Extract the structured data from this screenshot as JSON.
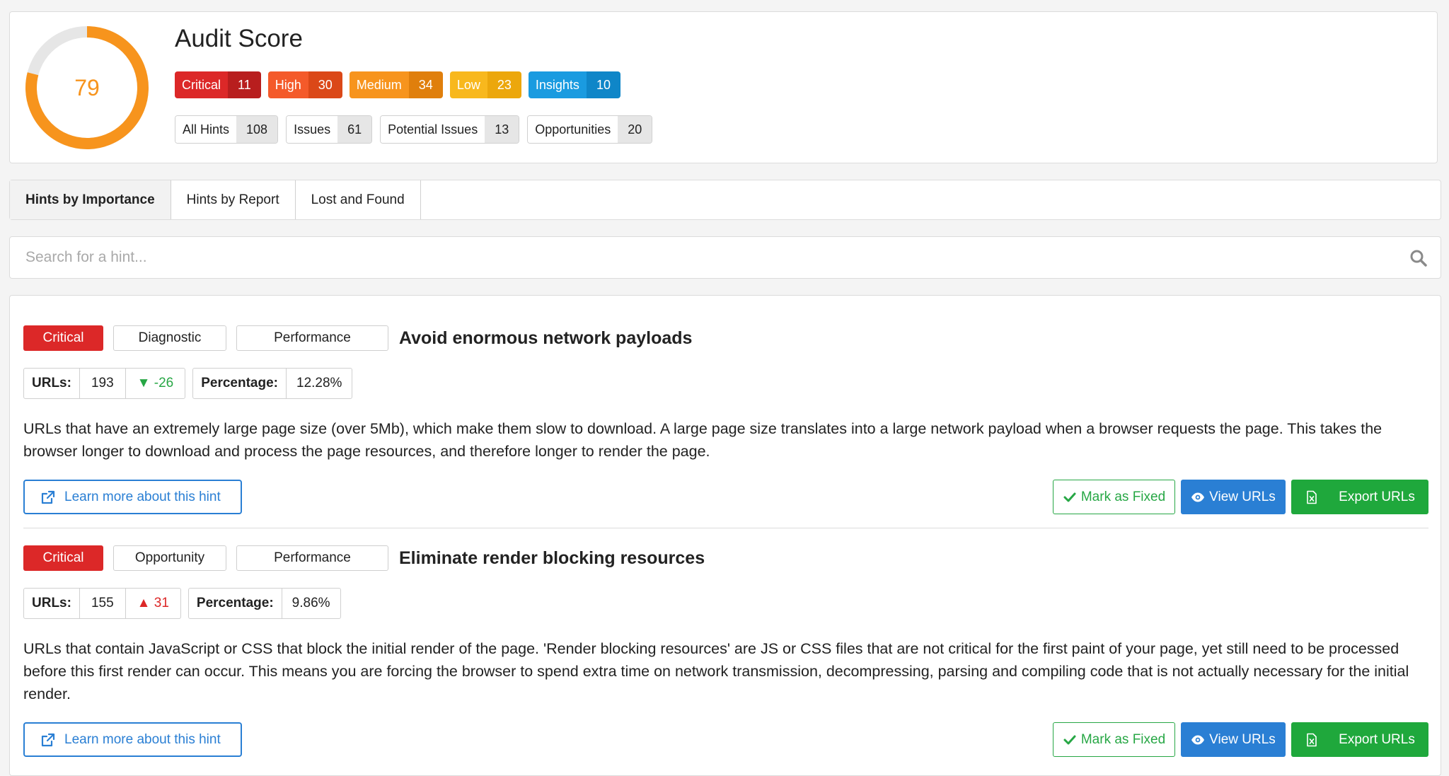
{
  "score": {
    "value": "79",
    "fraction": 0.79,
    "color": "#f7941d",
    "title": "Audit Score"
  },
  "severities": [
    {
      "label": "Critical",
      "count": "11",
      "color": "#dc2828",
      "dark": "#b81e1e"
    },
    {
      "label": "High",
      "count": "30",
      "color": "#f45a2a",
      "dark": "#db4818"
    },
    {
      "label": "Medium",
      "count": "34",
      "color": "#f7941d",
      "dark": "#e07f0c"
    },
    {
      "label": "Low",
      "count": "23",
      "color": "#f8b81d",
      "dark": "#eca70c"
    },
    {
      "label": "Insights",
      "count": "10",
      "color": "#1a9be0",
      "dark": "#0f86c8"
    }
  ],
  "counts": [
    {
      "label": "All Hints",
      "count": "108"
    },
    {
      "label": "Issues",
      "count": "61"
    },
    {
      "label": "Potential Issues",
      "count": "13"
    },
    {
      "label": "Opportunities",
      "count": "20"
    }
  ],
  "tabs": [
    {
      "label": "Hints by Importance",
      "active": true
    },
    {
      "label": "Hints by Report",
      "active": false
    },
    {
      "label": "Lost and Found",
      "active": false
    }
  ],
  "search": {
    "placeholder": "Search for a hint..."
  },
  "hints": [
    {
      "severity": "Critical",
      "type": "Diagnostic",
      "category": "Performance",
      "title": "Avoid enormous network payloads",
      "urls_label": "URLs:",
      "urls": "193",
      "delta": "-26",
      "delta_dir": "down",
      "pct_label": "Percentage:",
      "pct": "12.28%",
      "description": "URLs that have an extremely large page size (over 5Mb), which make them slow to download. A large page size translates into a large network payload when a browser requests the page. This takes the browser longer to download and process the page resources, and therefore longer to render the page.",
      "learn": "Learn more about this hint",
      "mark_fixed": "Mark as Fixed",
      "view_urls": "View URLs",
      "export_urls": "Export URLs"
    },
    {
      "severity": "Critical",
      "type": "Opportunity",
      "category": "Performance",
      "title": "Eliminate render blocking resources",
      "urls_label": "URLs:",
      "urls": "155",
      "delta": "31",
      "delta_dir": "up",
      "pct_label": "Percentage:",
      "pct": "9.86%",
      "description": "URLs that contain JavaScript or CSS that block the initial render of the page. 'Render blocking resources' are JS or CSS files that are not critical for the first paint of your page, yet still need to be processed before this first render can occur. This means you are forcing the browser to spend extra time on network transmission, decompressing, parsing and compiling code that is not actually necessary for the initial render.",
      "learn": "Learn more about this hint",
      "mark_fixed": "Mark as Fixed",
      "view_urls": "View URLs",
      "export_urls": "Export URLs"
    }
  ]
}
